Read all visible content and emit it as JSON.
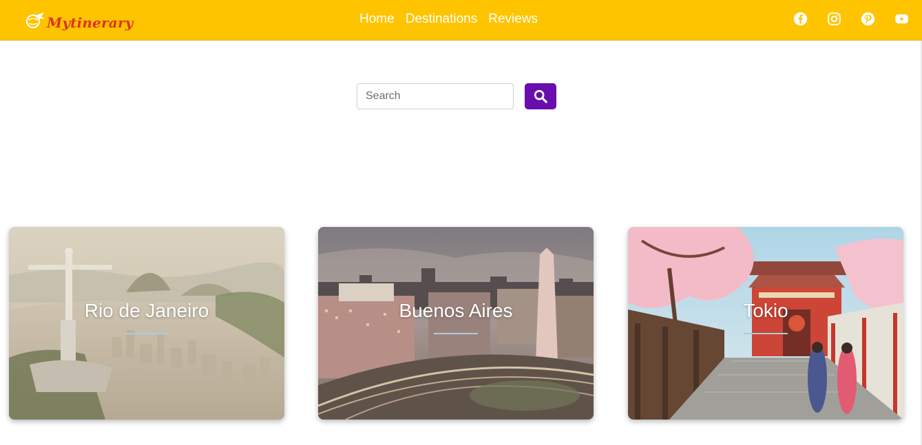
{
  "header": {
    "brand": "Mytinerary",
    "nav": [
      {
        "label": "Home"
      },
      {
        "label": "Destinations"
      },
      {
        "label": "Reviews"
      }
    ],
    "social_icons": [
      "facebook-icon",
      "instagram-icon",
      "pinterest-icon",
      "youtube-icon"
    ],
    "background_color": "#ffc400",
    "brand_color": "#e0321c"
  },
  "search": {
    "placeholder": "Search",
    "value": "",
    "button_icon": "search-icon",
    "button_color": "#6a0dad"
  },
  "cities": [
    {
      "name": "Rio de Janeiro"
    },
    {
      "name": "Buenos Aires"
    },
    {
      "name": "Tokio"
    }
  ]
}
